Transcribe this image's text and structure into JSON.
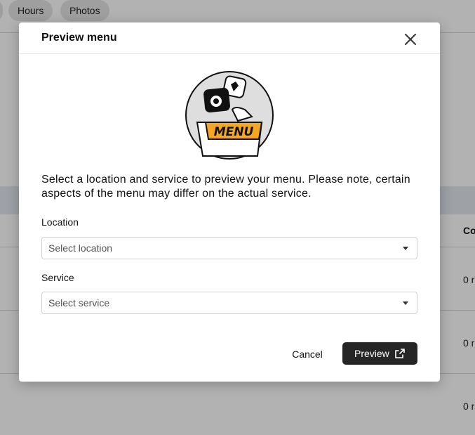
{
  "background": {
    "tabs": [
      "Hours",
      "Photos"
    ],
    "column_header": "Co",
    "rows": [
      "0 r",
      "0 r",
      "0 r"
    ]
  },
  "dialog": {
    "title": "Preview menu",
    "illustration_label": "MENU",
    "description": "Select a location and service to preview your menu. Please note, certain aspects of the menu may differ on the actual service.",
    "location": {
      "label": "Location",
      "placeholder": "Select location"
    },
    "service": {
      "label": "Service",
      "placeholder": "Select service"
    },
    "cancel_label": "Cancel",
    "preview_label": "Preview"
  },
  "colors": {
    "primary_button": "#262626",
    "menu_badge": "#f5a623",
    "overlay": "rgba(0,0,0,0.30)"
  },
  "icons": {
    "close": "close-icon",
    "external_link": "external-link-icon",
    "dropdown": "chevron-down-icon"
  }
}
